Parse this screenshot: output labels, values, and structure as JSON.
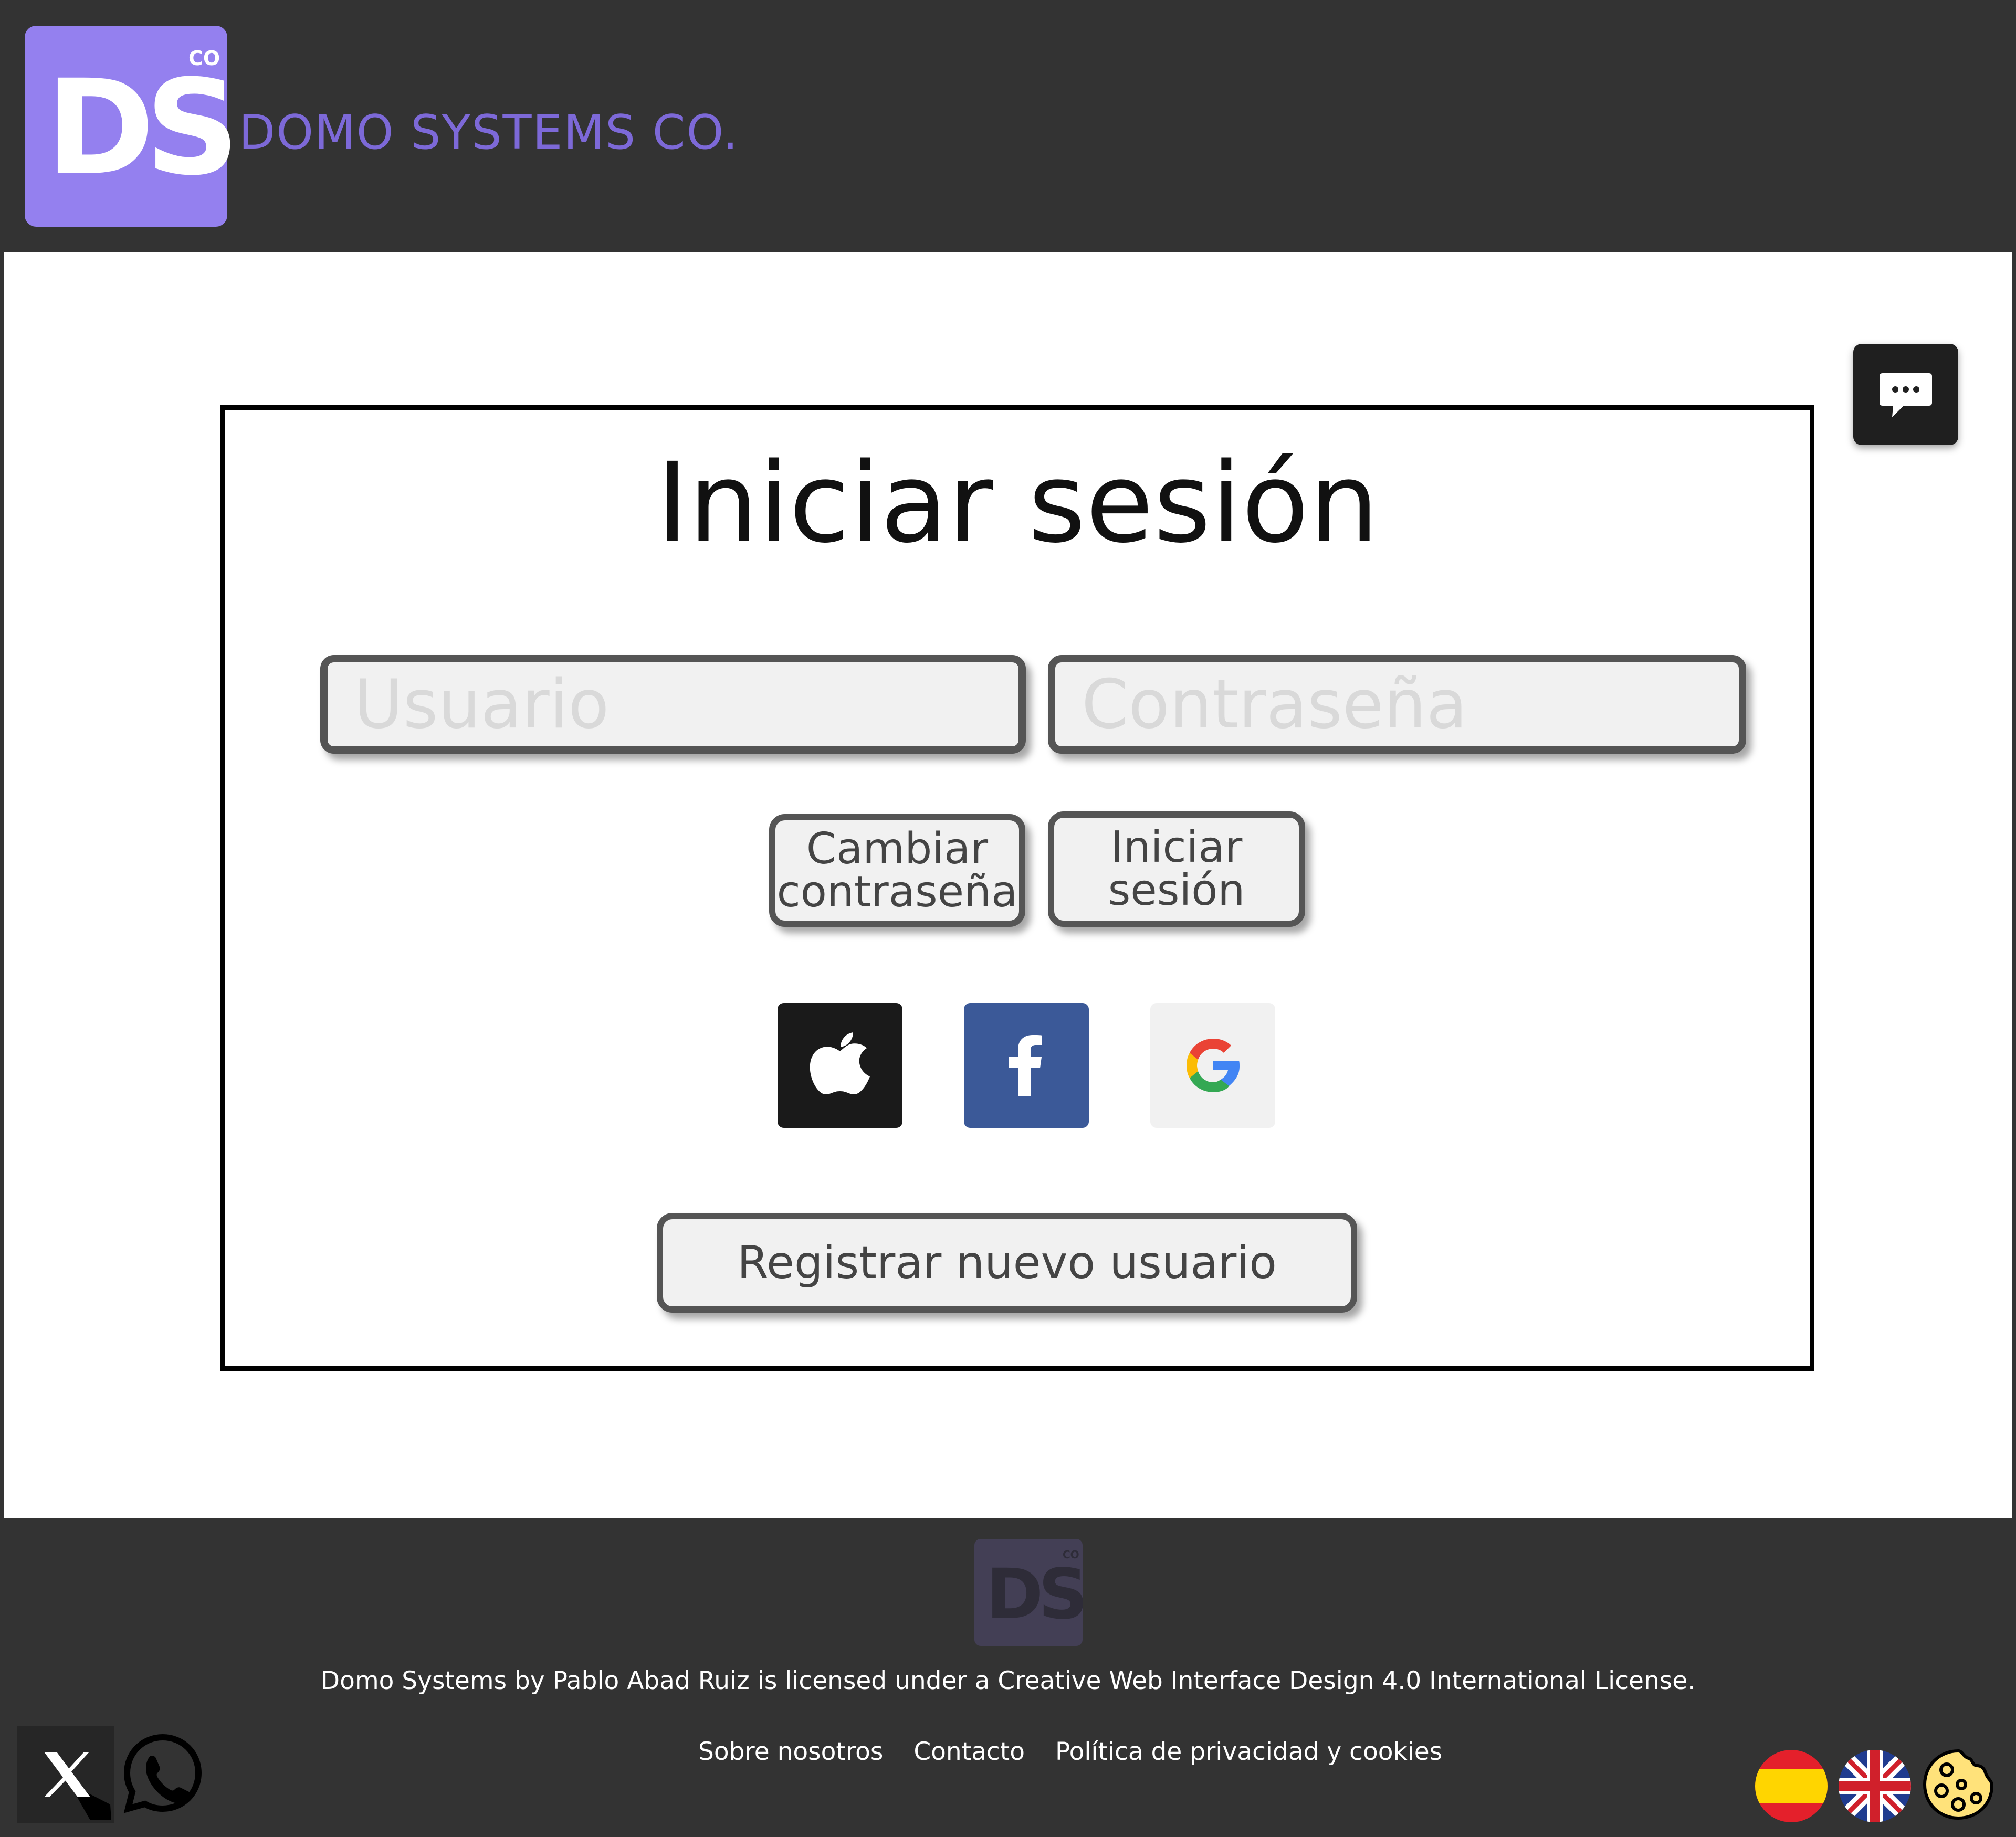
{
  "header": {
    "logo_text": "DS",
    "logo_superscript": "CO",
    "brand_name": "DOMO SYSTEMS CO."
  },
  "chat": {
    "icon": "chat-bubble-icon"
  },
  "login": {
    "title": "Iniciar sesión",
    "username_placeholder": "Usuario",
    "username_value": "",
    "password_placeholder": "Contraseña",
    "password_value": "",
    "change_password_label": "Cambiar contraseña",
    "login_button_label": "Iniciar sesión",
    "register_button_label": "Registrar nuevo usuario",
    "social": [
      {
        "name": "apple",
        "icon": "apple-icon"
      },
      {
        "name": "facebook",
        "icon": "facebook-icon"
      },
      {
        "name": "google",
        "icon": "google-icon"
      }
    ]
  },
  "footer": {
    "logo_text": "DS",
    "logo_superscript": "CO",
    "license": "Domo Systems by Pablo Abad Ruiz is licensed under a Creative Web Interface Design 4.0 International License.",
    "links": [
      "Sobre nosotros",
      "Contacto",
      "Política de privacidad y cookies"
    ],
    "social_icons": [
      "x-icon",
      "whatsapp-icon"
    ],
    "language_flags": [
      "spain-flag-icon",
      "uk-flag-icon"
    ],
    "cookie_icon": "cookie-icon"
  },
  "colors": {
    "header_bg": "#333333",
    "brand_purple": "#9480ef",
    "brand_text": "#7d69d8",
    "facebook_blue": "#3b5998"
  }
}
